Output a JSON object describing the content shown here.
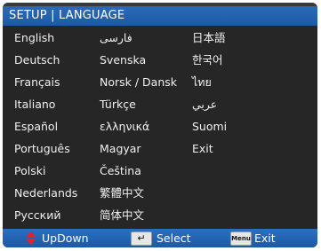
{
  "title": "SETUP | LANGUAGE",
  "languages": [
    [
      "English",
      "فارسی",
      "日本語"
    ],
    [
      "Deutsch",
      "Svenska",
      "한국어"
    ],
    [
      "Français",
      "Norsk / Dansk",
      "ไทย"
    ],
    [
      "Italiano",
      "Türkçe",
      "عربي"
    ],
    [
      "Español",
      "ελληνικά",
      "Suomi"
    ],
    [
      "Português",
      "Magyar",
      "Exit"
    ],
    [
      "Polski",
      "Čeština",
      ""
    ],
    [
      "Nederlands",
      "繁體中文",
      ""
    ],
    [
      "Русский",
      "简体中文",
      ""
    ]
  ],
  "footer": {
    "updown_label": "UpDown",
    "select_label": "Select",
    "exit_label": "Exit",
    "enter_icon_glyph": "↵",
    "menu_icon_text": "Menu",
    "icons": [
      "updown-icon",
      "enter-key-icon",
      "menu-key-icon"
    ]
  },
  "colors": {
    "titlebar": "#1d5aa6",
    "footer": "#1b58a8",
    "arrow": "#e8202a",
    "text": "#f0f0f0"
  }
}
